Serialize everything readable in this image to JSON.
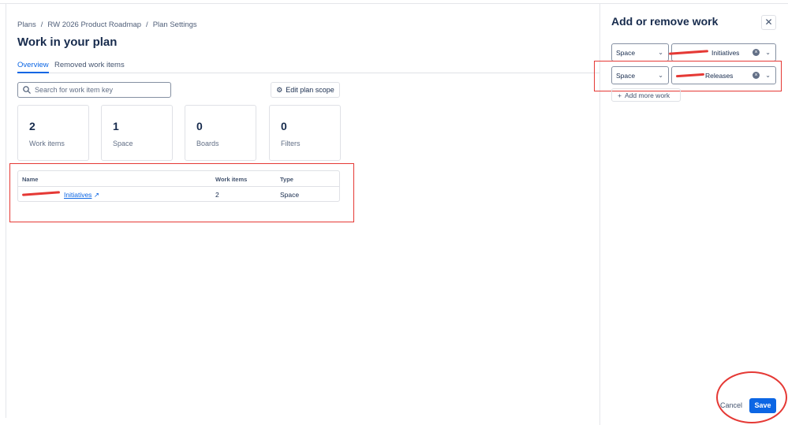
{
  "breadcrumbs": [
    "Plans",
    "/",
    "RW 2026 Product Roadmap",
    "/",
    "Plan Settings"
  ],
  "page_title": "Work in your plan",
  "tabs": [
    {
      "label": "Overview",
      "active": true
    },
    {
      "label": "Removed work items",
      "active": false
    }
  ],
  "search": {
    "placeholder": "Search for work item key"
  },
  "edit_scope_label": "Edit plan scope",
  "stats": [
    {
      "value": "2",
      "label": "Work items"
    },
    {
      "value": "1",
      "label": "Space"
    },
    {
      "value": "0",
      "label": "Boards"
    },
    {
      "value": "0",
      "label": "Filters"
    }
  ],
  "table": {
    "headers": [
      "Name",
      "Work items",
      "Type"
    ],
    "rows": [
      {
        "name": "Initiatives",
        "work_items": "2",
        "type": "Space"
      }
    ]
  },
  "panel": {
    "title": "Add or remove work",
    "rows": [
      {
        "type": "Space",
        "value": "Initiatives"
      },
      {
        "type": "Space",
        "value": "Releases"
      }
    ],
    "add_more_label": "Add more work",
    "cancel_label": "Cancel",
    "save_label": "Save"
  },
  "colors": {
    "accent": "#0c66e4",
    "annotation": "#e53935"
  }
}
